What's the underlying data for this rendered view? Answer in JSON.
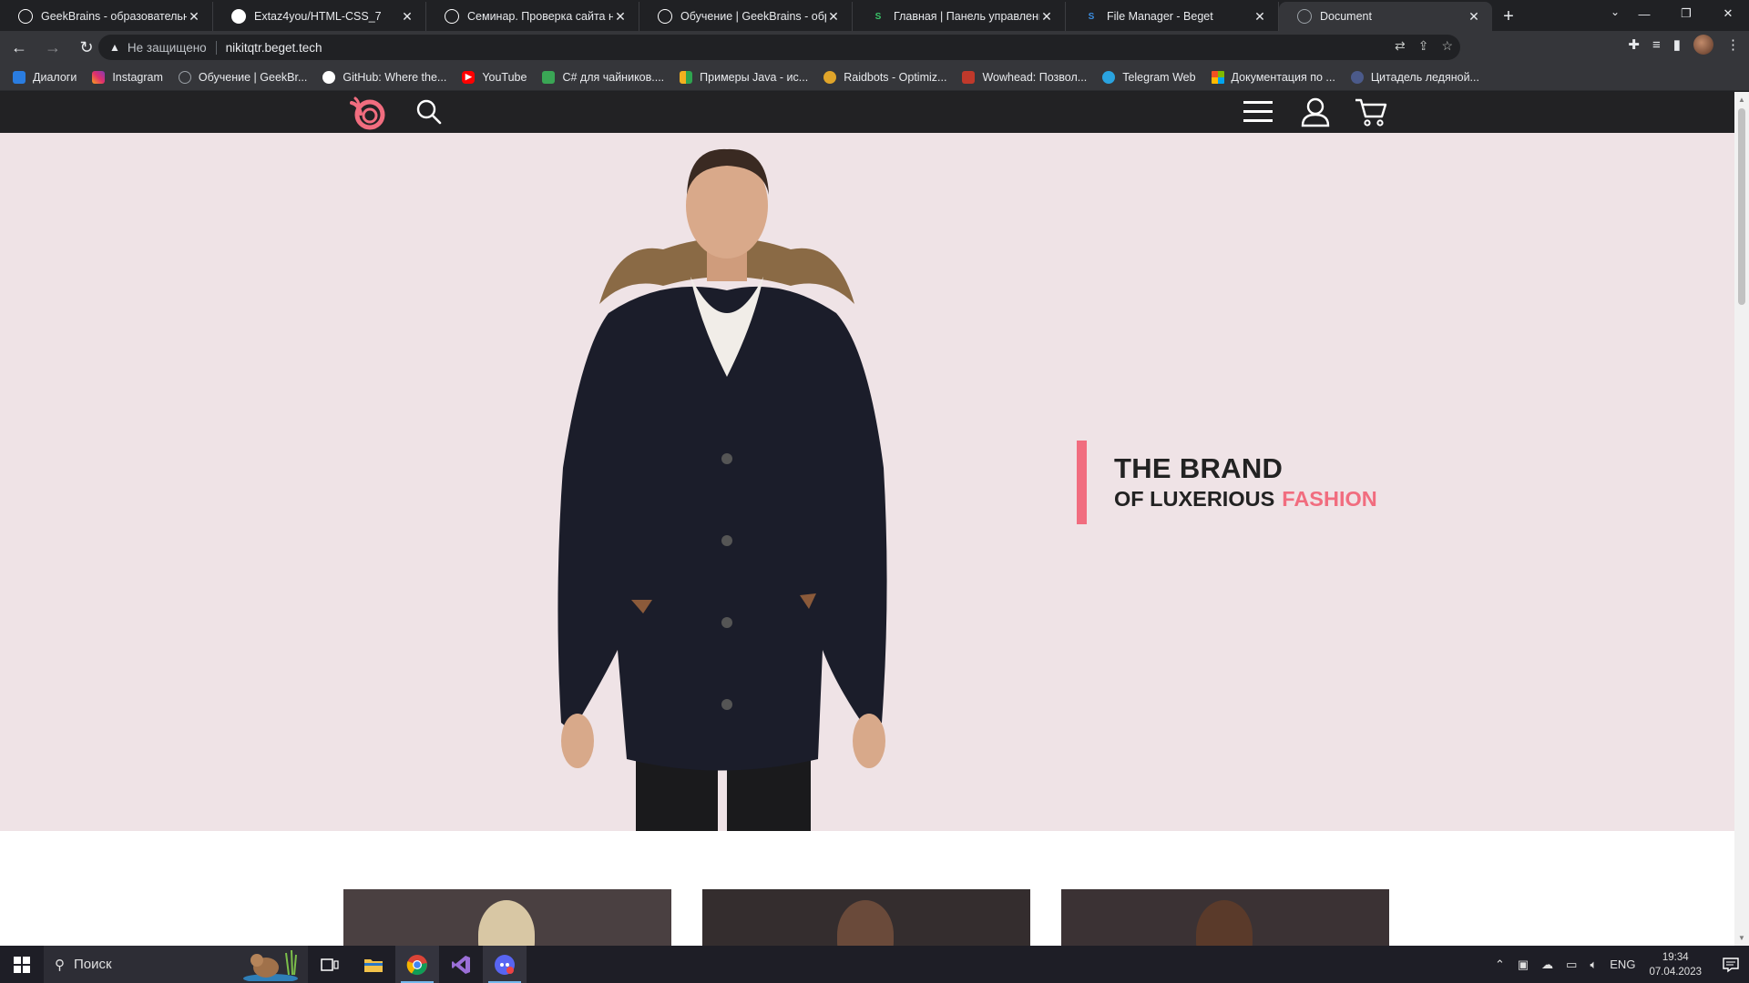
{
  "browser": {
    "tabs": [
      {
        "title": "GeekBrains - образовательный",
        "favicon": "geekbrains-icon",
        "color": "#ffffff"
      },
      {
        "title": "Extaz4you/HTML-CSS_7",
        "favicon": "github-icon",
        "color": "#ffffff"
      },
      {
        "title": "Семинар. Проверка сайта на с",
        "favicon": "geekbrains-icon",
        "color": "#ffffff"
      },
      {
        "title": "Обучение | GeekBrains - образ",
        "favicon": "geekbrains-icon",
        "color": "#ffffff"
      },
      {
        "title": "Главная | Панель управления в",
        "favicon": "beget-icon",
        "color": "#3ac569"
      },
      {
        "title": "File Manager - Beget",
        "favicon": "beget-icon",
        "color": "#3b8de0"
      },
      {
        "title": "Document",
        "favicon": "globe-icon",
        "color": "#9aa0a6",
        "active": true
      }
    ],
    "new_tab": "+",
    "security_label": "Не защищено",
    "url": "nikitqtr.beget.tech",
    "bookmarks": [
      {
        "label": "Диалоги",
        "color": "#2a7de1",
        "icon": "messages-icon"
      },
      {
        "label": "Instagram",
        "color": "#e1306c",
        "icon": "instagram-icon"
      },
      {
        "label": "Обучение | GeekBr...",
        "color": "#9aa0a6",
        "icon": "geekbrains-icon"
      },
      {
        "label": "GitHub: Where the...",
        "color": "#ffffff",
        "icon": "github-icon"
      },
      {
        "label": "YouTube",
        "color": "#ff0000",
        "icon": "youtube-icon"
      },
      {
        "label": "C# для чайников....",
        "color": "#3aa655",
        "icon": "book-icon"
      },
      {
        "label": "Примеры Java - ис...",
        "color": "#f2b01e",
        "icon": "java-examples-icon"
      },
      {
        "label": "Raidbots - Optimiz...",
        "color": "#e0a52a",
        "icon": "raidbots-icon"
      },
      {
        "label": "Wowhead: Позвол...",
        "color": "#c0392b",
        "icon": "wowhead-icon"
      },
      {
        "label": "Telegram Web",
        "color": "#2aa3df",
        "icon": "telegram-icon"
      },
      {
        "label": "Документация по ...",
        "color": "#f35325",
        "icon": "microsoft-icon"
      },
      {
        "label": "Цитадель ледяной...",
        "color": "#4b5a8a",
        "icon": "citadel-icon"
      }
    ]
  },
  "site": {
    "colors": {
      "header_bg": "#222224",
      "hero_bg": "#efe3e6",
      "accent": "#f16d7f",
      "text": "#222222"
    },
    "hero": {
      "title_line1": "THE BRAND",
      "title_line2": "OF LUXERIOUS",
      "title_accent": "FASHION"
    },
    "header_icons": [
      "logo-icon",
      "search-icon",
      "menu-icon",
      "user-icon",
      "cart-icon"
    ]
  },
  "taskbar": {
    "search_placeholder": "Поиск",
    "lang": "ENG",
    "time": "19:34",
    "date": "07.04.2023",
    "apps": [
      "windows-start-icon",
      "task-view-icon",
      "file-explorer-icon",
      "chrome-icon",
      "visual-studio-icon",
      "discord-icon"
    ]
  }
}
